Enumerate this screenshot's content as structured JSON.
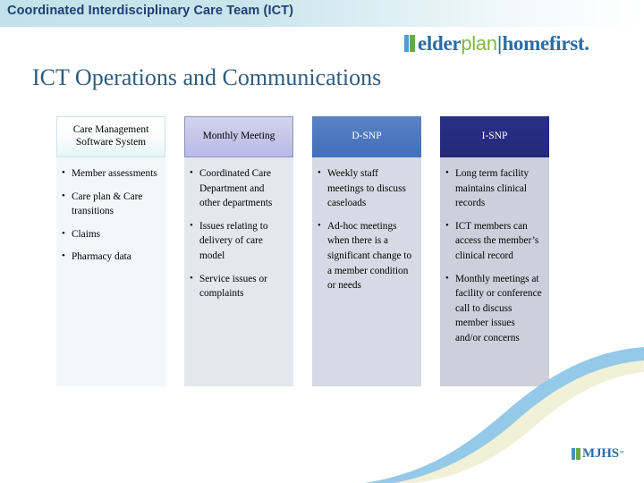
{
  "header": {
    "bar_title": "Coordinated Interdisciplinary Care Team (ICT)",
    "bar_bg_color": "#c2e2ea",
    "bar_text_color": "#1f3f73"
  },
  "brand": {
    "part_elder": "elder",
    "part_plan": "plan",
    "separator": "|",
    "part_homefirst": "homefirst.",
    "mark_blue": "#4b9ed6",
    "mark_green": "#6aa844",
    "text_blue": "#2a6ca8",
    "text_green": "#7fb843"
  },
  "slide": {
    "heading": "ICT Operations and Communications",
    "heading_color": "#2e5c80"
  },
  "table": {
    "columns": [
      {
        "header": "Care Management Software System",
        "header_bg": "#f4fbfc",
        "header_text_color": "#000000",
        "body_bg": "#f2f8f9",
        "bullets": [
          "Member assessments",
          "Care plan & Care transitions",
          "Claims",
          "Pharmacy data"
        ]
      },
      {
        "header": "Monthly Meeting",
        "header_bg": "#c6c8e8",
        "header_text_color": "#000000",
        "body_bg": "#e3e8ef",
        "bullets": [
          "Coordinated Care Department and other departments",
          "Issues relating to delivery of care model",
          "Service issues or complaints"
        ]
      },
      {
        "header": "D-SNP",
        "header_bg": "#4d78bf",
        "header_text_color": "#ffffff",
        "body_bg": "#d7dae4",
        "bullets": [
          "Weekly staff meetings to discuss caseloads",
          "Ad-hoc meetings when there is a significant change to a  member condition or needs"
        ]
      },
      {
        "header": "I-SNP",
        "header_bg": "#272c80",
        "header_text_color": "#ffffff",
        "body_bg": "#cfcfdc",
        "bullets": [
          "Long term facility maintains clinical records",
          "ICT members can access the member’s clinical record",
          "Monthly meetings at facility or conference call to discuss member issues and/or concerns"
        ]
      }
    ]
  },
  "footer": {
    "mjhs_text": "MJHS",
    "mjhs_tm": "™",
    "mark_blue": "#3f8fd0",
    "mark_green": "#6aa844",
    "text_color": "#2a6ca8"
  },
  "decor": {
    "swoosh_blue": "#8ec6e8",
    "swoosh_cream": "#eff0d4"
  }
}
